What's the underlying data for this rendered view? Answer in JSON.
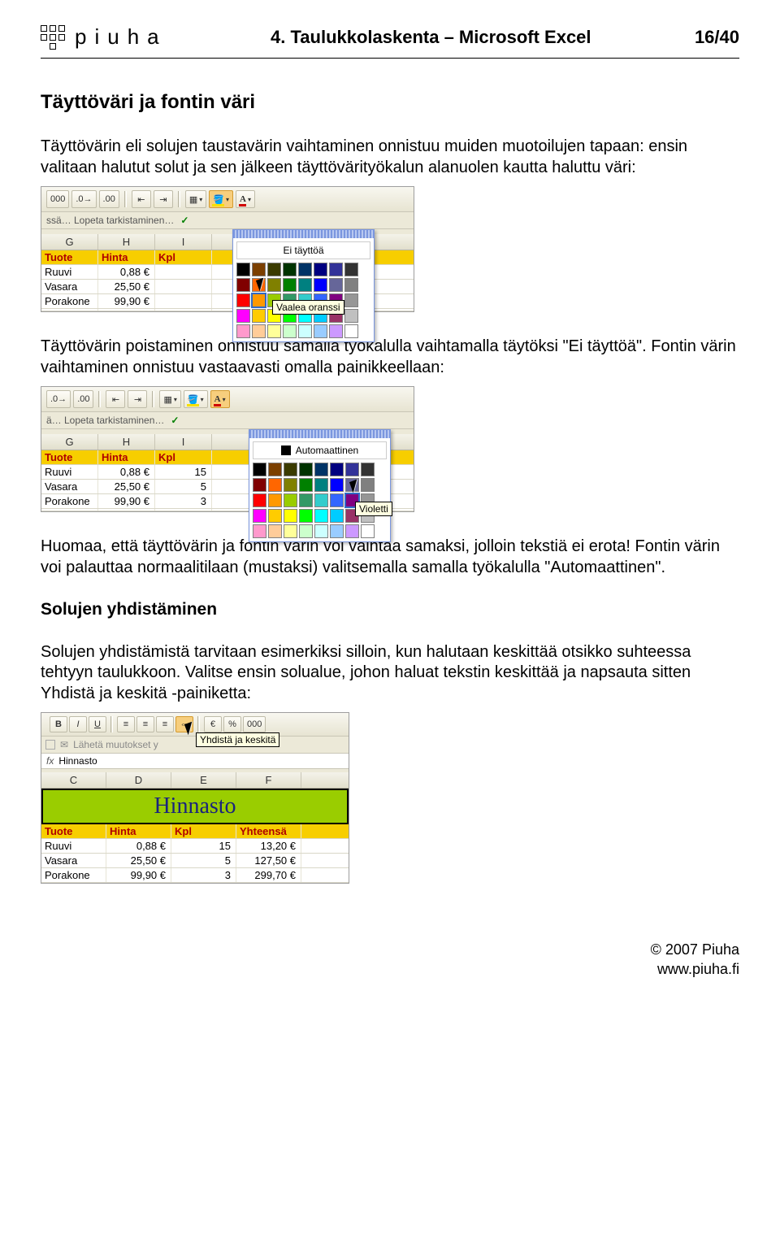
{
  "header": {
    "brand": "piuha",
    "title": "4. Taulukkolaskenta – Microsoft Excel",
    "page": "16/40"
  },
  "h2_1": "Täyttöväri ja fontin väri",
  "p1": "Täyttövärin eli solujen taustavärin vaihtaminen onnistuu muiden muotoilujen tapaan: ensin valitaan halutut solut ja sen jälkeen täyttövärityökalun alanuolen kautta haluttu väri:",
  "shot1": {
    "toolbar_text": "000",
    "status_text": "ssä…  Lopeta tarkistaminen…",
    "cols": [
      "G",
      "H",
      "I"
    ],
    "header_row": [
      "Tuote",
      "Hinta",
      "Kpl"
    ],
    "rows": [
      [
        "Ruuvi",
        "0,88 €",
        ""
      ],
      [
        "Vasara",
        "25,50 €",
        ""
      ],
      [
        "Porakone",
        "99,90 €",
        ""
      ]
    ],
    "palette_label": "Ei täyttöä",
    "tooltip": "Vaalea oranssi"
  },
  "p2": "Täyttövärin poistaminen onnistuu samalla työkalulla vaihtamalla täytöksi \"Ei täyttöä\". Fontin värin vaihtaminen onnistuu vastaavasti omalla painikkeellaan:",
  "shot2": {
    "status_text": "ä…  Lopeta tarkistaminen…",
    "cols": [
      "G",
      "H",
      "I"
    ],
    "header_row": [
      "Tuote",
      "Hinta",
      "Kpl"
    ],
    "rows": [
      [
        "Ruuvi",
        "0,88 €",
        "15"
      ],
      [
        "Vasara",
        "25,50 €",
        "5"
      ],
      [
        "Porakone",
        "99,90 €",
        "3"
      ]
    ],
    "palette_label": "Automaattinen",
    "tooltip": "Violetti"
  },
  "p3": "Huomaa, että täyttövärin ja fontin värin voi vaihtaa samaksi, jolloin tekstiä ei erota! Fontin värin voi palauttaa normaalitilaan (mustaksi) valitsemalla samalla työkalulla \"Automaattinen\".",
  "h2_2": "Solujen yhdistäminen",
  "p4": "Solujen yhdistämistä tarvitaan esimerkiksi silloin, kun halutaan keskittää otsikko suhteessa tehtyyn taulukkoon. Valitse ensin solualue, johon haluat tekstin keskittää ja napsauta sitten Yhdistä ja keskitä -painiketta:",
  "shot3": {
    "send_text": "Lähetä muutokset y",
    "tooltip": "Yhdistä ja keskitä",
    "fx": "Hinnasto",
    "cols": [
      "C",
      "D",
      "E",
      "F"
    ],
    "merged_title": "Hinnasto",
    "header_row": [
      "Tuote",
      "Hinta",
      "Kpl",
      "Yhteensä"
    ],
    "rows": [
      [
        "Ruuvi",
        "0,88 €",
        "15",
        "13,20 €"
      ],
      [
        "Vasara",
        "25,50 €",
        "5",
        "127,50 €"
      ],
      [
        "Porakone",
        "99,90 €",
        "3",
        "299,70 €"
      ]
    ]
  },
  "footer": {
    "l1": "© 2007 Piuha",
    "l2": "www.piuha.fi"
  },
  "chart_data": {
    "type": "table",
    "title": "Hinnasto",
    "columns": [
      "Tuote",
      "Hinta",
      "Kpl",
      "Yhteensä"
    ],
    "rows": [
      [
        "Ruuvi",
        0.88,
        15,
        13.2
      ],
      [
        "Vasara",
        25.5,
        5,
        127.5
      ],
      [
        "Porakone",
        99.9,
        3,
        299.7
      ]
    ]
  }
}
